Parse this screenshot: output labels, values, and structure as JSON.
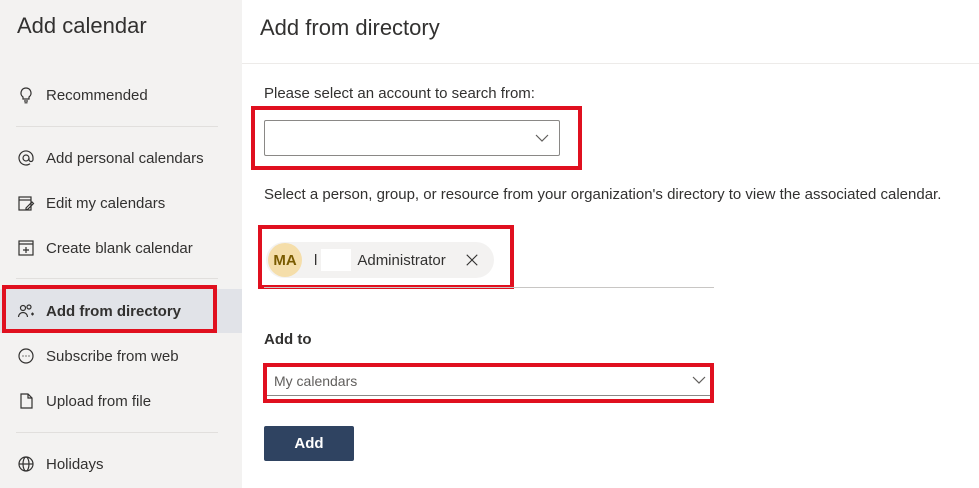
{
  "sidebar": {
    "title": "Add calendar",
    "items": [
      {
        "label": "Recommended",
        "icon": "lightbulb-icon"
      },
      {
        "label": "Add personal calendars",
        "icon": "at-sign-icon"
      },
      {
        "label": "Edit my calendars",
        "icon": "edit-calendar-icon"
      },
      {
        "label": "Create blank calendar",
        "icon": "calendar-plus-icon"
      },
      {
        "label": "Add from directory",
        "icon": "people-add-icon",
        "active": true
      },
      {
        "label": "Subscribe from web",
        "icon": "link-icon"
      },
      {
        "label": "Upload from file",
        "icon": "file-icon"
      },
      {
        "label": "Holidays",
        "icon": "globe-icon"
      }
    ]
  },
  "main": {
    "title": "Add from directory",
    "account_prompt": "Please select an account to search from:",
    "account_value": "",
    "directory_prompt": "Select a person, group, or resource from your organization's directory to view the associated calendar.",
    "persona": {
      "initials": "MA",
      "prefix": "l",
      "name": "Administrator"
    },
    "add_to_label": "Add to",
    "add_to_value": "My calendars",
    "add_button": "Add"
  },
  "colors": {
    "highlight": "#e0101f",
    "button": "#2f4361",
    "avatar_bg": "#f5deaa",
    "sidebar_bg": "#f3f2f1",
    "active_item_bg": "#e1e3e8"
  }
}
